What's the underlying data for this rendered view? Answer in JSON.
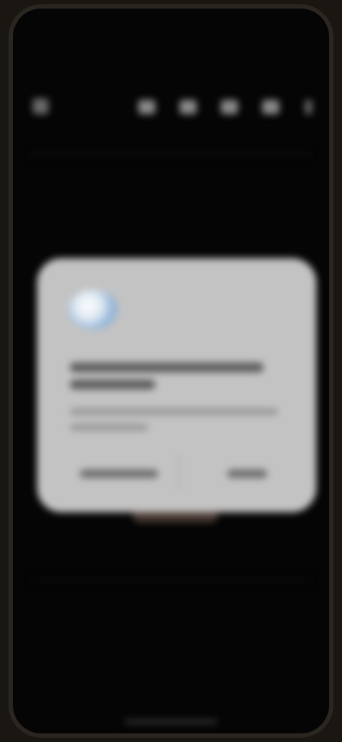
{
  "status_bar": {
    "time": "",
    "indicators": ""
  },
  "app": {
    "title": "",
    "subtitle": "",
    "heading": ""
  },
  "toolbar": {
    "left_icon": "back-icon",
    "icons": [
      "text-format-icon",
      "list-icon",
      "image-icon",
      "share-icon"
    ],
    "right_icon": "more-icon"
  },
  "dialog": {
    "icon": "app-icon",
    "title": "",
    "body": "",
    "secondary_button": "",
    "primary_button": ""
  },
  "colors": {
    "background": "#050505",
    "dialog_background": "#c3c3c3",
    "dialog_icon_accent": "#8fb3d8"
  }
}
